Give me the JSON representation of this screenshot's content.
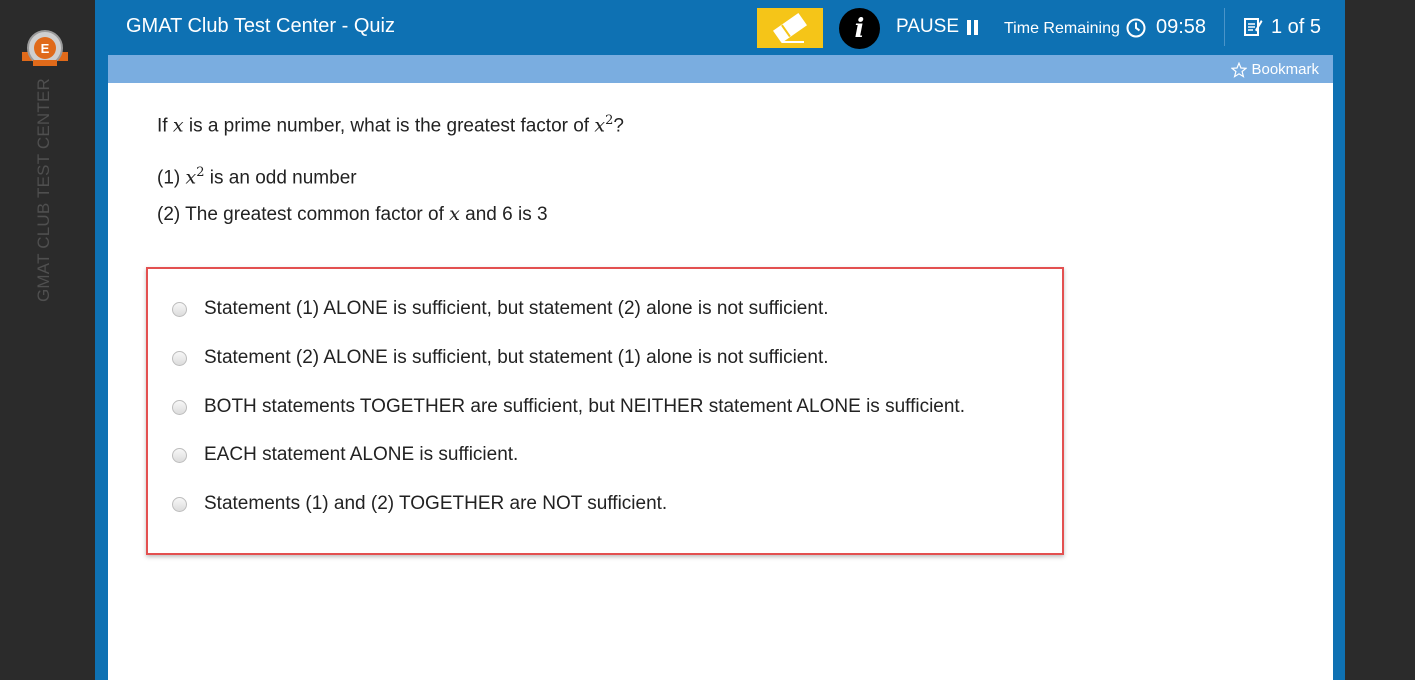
{
  "sidebar": {
    "vertical_title": "GMAT CLUB TEST CENTER"
  },
  "header": {
    "title": "GMAT Club Test Center - Quiz",
    "pause_label": "PAUSE",
    "time_label": "Time Remaining",
    "time_value": "09:58",
    "progress": "1 of 5"
  },
  "subbar": {
    "bookmark_label": "Bookmark"
  },
  "question": {
    "stem_before": "If ",
    "stem_var": "x",
    "stem_middle": " is a prime number, what is the greatest factor of ",
    "stem_var2": "x",
    "stem_exp": "2",
    "stem_end": "?",
    "statement1_prefix": "(1) ",
    "statement1_var": "x",
    "statement1_exp": "2",
    "statement1_rest": " is an odd number",
    "statement2_prefix": "(2) The greatest common factor of ",
    "statement2_var": "x",
    "statement2_rest": " and 6 is 3"
  },
  "answers": [
    "Statement (1) ALONE is sufficient, but statement (2) alone is not sufficient.",
    "Statement (2) ALONE is sufficient, but statement (1) alone is not sufficient.",
    "BOTH statements TOGETHER are sufficient, but NEITHER statement ALONE is sufficient.",
    "EACH statement ALONE is sufficient.",
    "Statements (1) and (2) TOGETHER are NOT sufficient."
  ],
  "colors": {
    "header_blue": "#0e71b3",
    "subbar_blue": "#7aade0",
    "eraser_yellow": "#f5c518",
    "highlight_red": "#e35050"
  },
  "icons": [
    "logo-badge",
    "eraser-icon",
    "info-icon",
    "pause-icon",
    "clock-icon",
    "notes-icon",
    "star-icon"
  ]
}
